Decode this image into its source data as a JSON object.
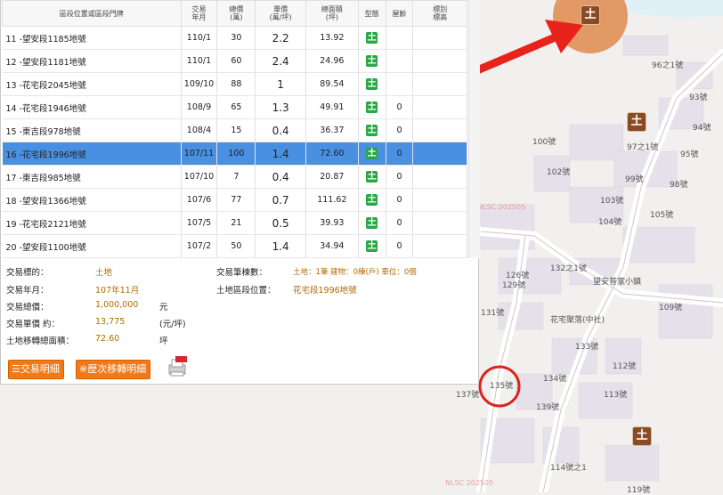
{
  "table": {
    "headers": [
      "區段位置或區段門牌",
      "交易\n年月",
      "總價\n(萬)",
      "單價\n(萬/坪)",
      "總面積\n(坪)",
      "型態",
      "屋齡",
      "標別\n標高"
    ],
    "rows": [
      {
        "addr": "11 -望安段1185地號",
        "date": "110/1",
        "total": "30",
        "unit": "2.2",
        "area": "13.92",
        "type": "土",
        "age": ""
      },
      {
        "addr": "12 -望安段1181地號",
        "date": "110/1",
        "total": "60",
        "unit": "2.4",
        "area": "24.96",
        "type": "土",
        "age": ""
      },
      {
        "addr": "13 -花宅段2045地號",
        "date": "109/10",
        "total": "88",
        "unit": "1",
        "area": "89.54",
        "type": "土",
        "age": ""
      },
      {
        "addr": "14 -花宅段1946地號",
        "date": "108/9",
        "total": "65",
        "unit": "1.3",
        "area": "49.91",
        "type": "土",
        "age": "0"
      },
      {
        "addr": "15 -東吉段978地號",
        "date": "108/4",
        "total": "15",
        "unit": "0.4",
        "area": "36.37",
        "type": "土",
        "age": "0"
      },
      {
        "addr": "16 -花宅段1996地號",
        "date": "107/11",
        "total": "100",
        "unit": "1.4",
        "area": "72.60",
        "type": "土",
        "age": "0"
      },
      {
        "addr": "17 -東吉段985地號",
        "date": "107/10",
        "total": "7",
        "unit": "0.4",
        "area": "20.87",
        "type": "土",
        "age": "0"
      },
      {
        "addr": "18 -望安段1366地號",
        "date": "107/6",
        "total": "77",
        "unit": "0.7",
        "area": "111.62",
        "type": "土",
        "age": "0"
      },
      {
        "addr": "19 -花宅段2121地號",
        "date": "107/5",
        "total": "21",
        "unit": "0.5",
        "area": "39.93",
        "type": "土",
        "age": "0"
      },
      {
        "addr": "20 -望安段1100地號",
        "date": "107/2",
        "total": "50",
        "unit": "1.4",
        "area": "34.94",
        "type": "土",
        "age": "0"
      }
    ],
    "selected_index": 5
  },
  "details": {
    "target_label": "交易標的：",
    "target_value": "土地",
    "date_label": "交易年月：",
    "date_value": "107年11月",
    "total_label": "交易總價：",
    "total_value": "1,000,000",
    "total_unit": "元",
    "unit_label": "交易單價 約：",
    "unit_value": "13,775",
    "unit_unit": "(元/坪)",
    "area_label": "土地移轉總面積：",
    "area_value": "72.60",
    "area_unit": "坪",
    "count_label": "交易筆棟數：",
    "count_value": "土地：1筆 建物：0棟(戶) 車位：0個",
    "location_label": "土地區段位置：",
    "location_value": "花宅段1996地號"
  },
  "buttons": {
    "detail": "☰交易明細",
    "history": "※歷次移轉明細"
  },
  "map": {
    "labels": [
      "96之1號",
      "93號",
      "94號",
      "95號",
      "100號",
      "97之1號",
      "102號",
      "99號",
      "98號",
      "103號",
      "104號",
      "105號",
      "126號",
      "129號",
      "132之1號",
      "望安普家小鎮",
      "131號",
      "109號",
      "花宅聚落(中社)",
      "133號",
      "112號",
      "134號",
      "113號",
      "135號",
      "137號",
      "139號",
      "114號之1",
      "119號"
    ],
    "watermarks": [
      "NLSC 202505",
      "NLSC 202505"
    ],
    "land_icon_glyph": "土"
  },
  "colors": {
    "accent_button": "#f07a1a",
    "selected_row": "#4a90e2",
    "arrow": "#e8231c",
    "highlight_circle": "#e08a4a"
  }
}
